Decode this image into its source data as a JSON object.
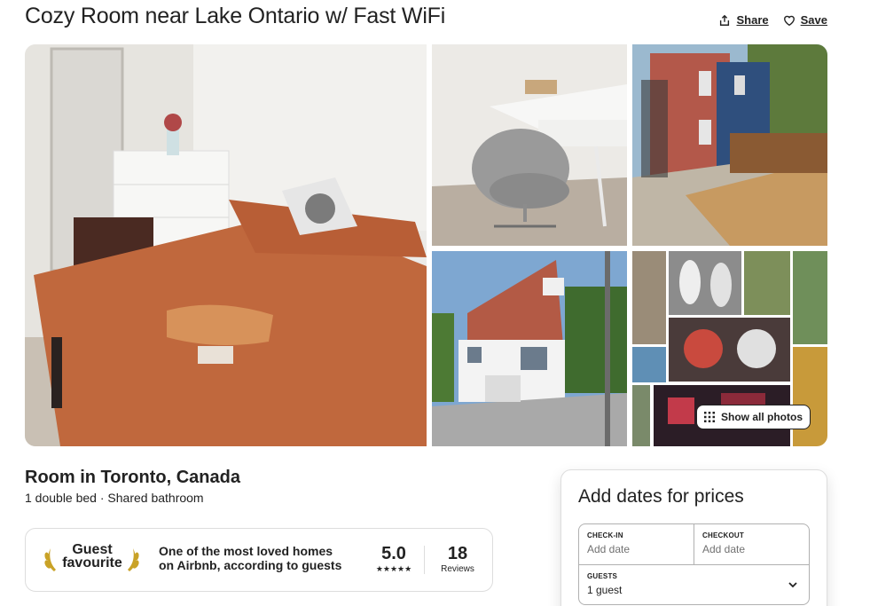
{
  "listing": {
    "title": "Cozy Room near Lake Ontario w/ Fast WiFi",
    "share_label": "Share",
    "save_label": "Save",
    "show_all_photos_label": "Show all photos",
    "room_title": "Room in Toronto, Canada",
    "room_details": "1 double bed · Shared bathroom"
  },
  "guest_favourite": {
    "label_line1": "Guest",
    "label_line2": "favourite",
    "description": "One of the most loved homes on Airbnb, according to guests",
    "rating": "5.0",
    "stars": "★★★★★",
    "reviews_count": "18",
    "reviews_label": "Reviews"
  },
  "booking": {
    "title": "Add dates for prices",
    "checkin_label": "CHECK-IN",
    "checkin_value": "Add date",
    "checkout_label": "CHECKOUT",
    "checkout_value": "Add date",
    "guests_label": "GUESTS",
    "guests_value": "1 guest"
  },
  "icons": {
    "share": "share-icon",
    "save": "heart-icon",
    "show_all": "grid-icon",
    "laurel": "laurel-icon",
    "chevron": "chevron-down-icon"
  }
}
